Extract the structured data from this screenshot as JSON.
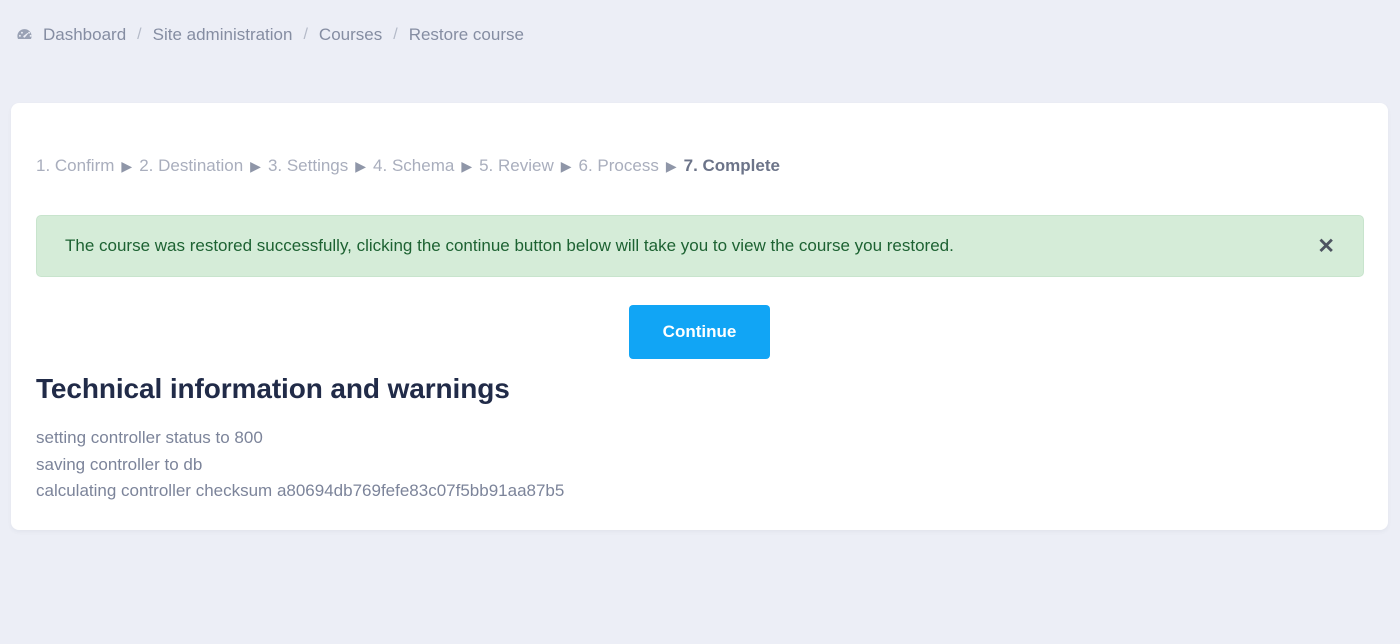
{
  "breadcrumb": {
    "icon": "tachometer-dashboard-icon",
    "separator": "/",
    "items": [
      {
        "label": "Dashboard"
      },
      {
        "label": "Site administration"
      },
      {
        "label": "Courses"
      },
      {
        "label": "Restore course"
      }
    ]
  },
  "steps": {
    "arrow": "▶",
    "items": [
      {
        "label": "1. Confirm",
        "active": false
      },
      {
        "label": "2. Destination",
        "active": false
      },
      {
        "label": "3. Settings",
        "active": false
      },
      {
        "label": "4. Schema",
        "active": false
      },
      {
        "label": "5. Review",
        "active": false
      },
      {
        "label": "6. Process",
        "active": false
      },
      {
        "label": "7. Complete",
        "active": true
      }
    ]
  },
  "alert": {
    "type": "success",
    "message": "The course was restored successfully, clicking the continue button below will take you to view the course you restored.",
    "close_label": "✕",
    "close_icon": "close-icon",
    "background_color": "#d5ecd8",
    "text_color": "#1d6232"
  },
  "actions": {
    "continue_label": "Continue",
    "continue_color": "#11a5f5"
  },
  "technical": {
    "heading": "Technical information and warnings",
    "lines": [
      "setting controller status to 800",
      "saving controller to db",
      "calculating controller checksum a80694db769fefe83c07f5bb91aa87b5"
    ]
  },
  "theme": {
    "page_background": "#eceef6",
    "card_background": "#ffffff",
    "muted_text": "#a9aebd",
    "heading_text": "#212b48"
  }
}
